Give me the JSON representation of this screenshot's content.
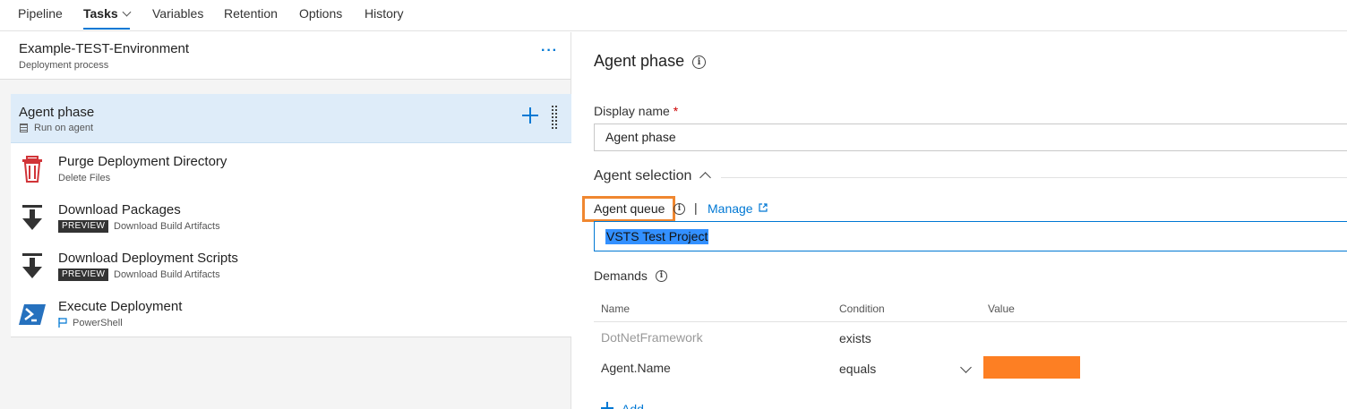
{
  "nav": {
    "tabs": [
      {
        "label": "Pipeline"
      },
      {
        "label": "Tasks"
      },
      {
        "label": "Variables"
      },
      {
        "label": "Retention"
      },
      {
        "label": "Options"
      },
      {
        "label": "History"
      }
    ],
    "active_tab": "Tasks"
  },
  "environment": {
    "title": "Example-TEST-Environment",
    "subtitle": "Deployment process",
    "more_label": "···"
  },
  "phase": {
    "title": "Agent phase",
    "subtitle": "Run on agent"
  },
  "tasks": [
    {
      "title": "Purge Deployment Directory",
      "subtitle": "Delete Files",
      "icon": "trash-icon"
    },
    {
      "title": "Download Packages",
      "badge": "PREVIEW",
      "subtitle": "Download Build Artifacts",
      "icon": "download-icon"
    },
    {
      "title": "Download Deployment Scripts",
      "badge": "PREVIEW",
      "subtitle": "Download Build Artifacts",
      "icon": "download-icon"
    },
    {
      "title": "Execute Deployment",
      "subtitle": "PowerShell",
      "icon": "powershell-icon"
    }
  ],
  "details": {
    "title": "Agent phase",
    "display_name_label": "Display name",
    "required_mark": "*",
    "display_name_value": "Agent phase",
    "agent_selection_label": "Agent selection",
    "agent_queue_label": "Agent queue",
    "separator": "|",
    "manage_label": "Manage",
    "agent_queue_value": "VSTS Test Project",
    "demands_label": "Demands",
    "demands_headers": {
      "name": "Name",
      "condition": "Condition",
      "value": "Value"
    },
    "demands": [
      {
        "name": "DotNetFramework",
        "condition": "exists",
        "value": ""
      },
      {
        "name": "Agent.Name",
        "condition": "equals",
        "value": ""
      }
    ],
    "add_label": "Add",
    "info_glyph": "i"
  },
  "colors": {
    "accent": "#0078d4",
    "highlight_border": "#f08730",
    "redaction": "#fd7f23",
    "selected_row": "#deecf9"
  }
}
